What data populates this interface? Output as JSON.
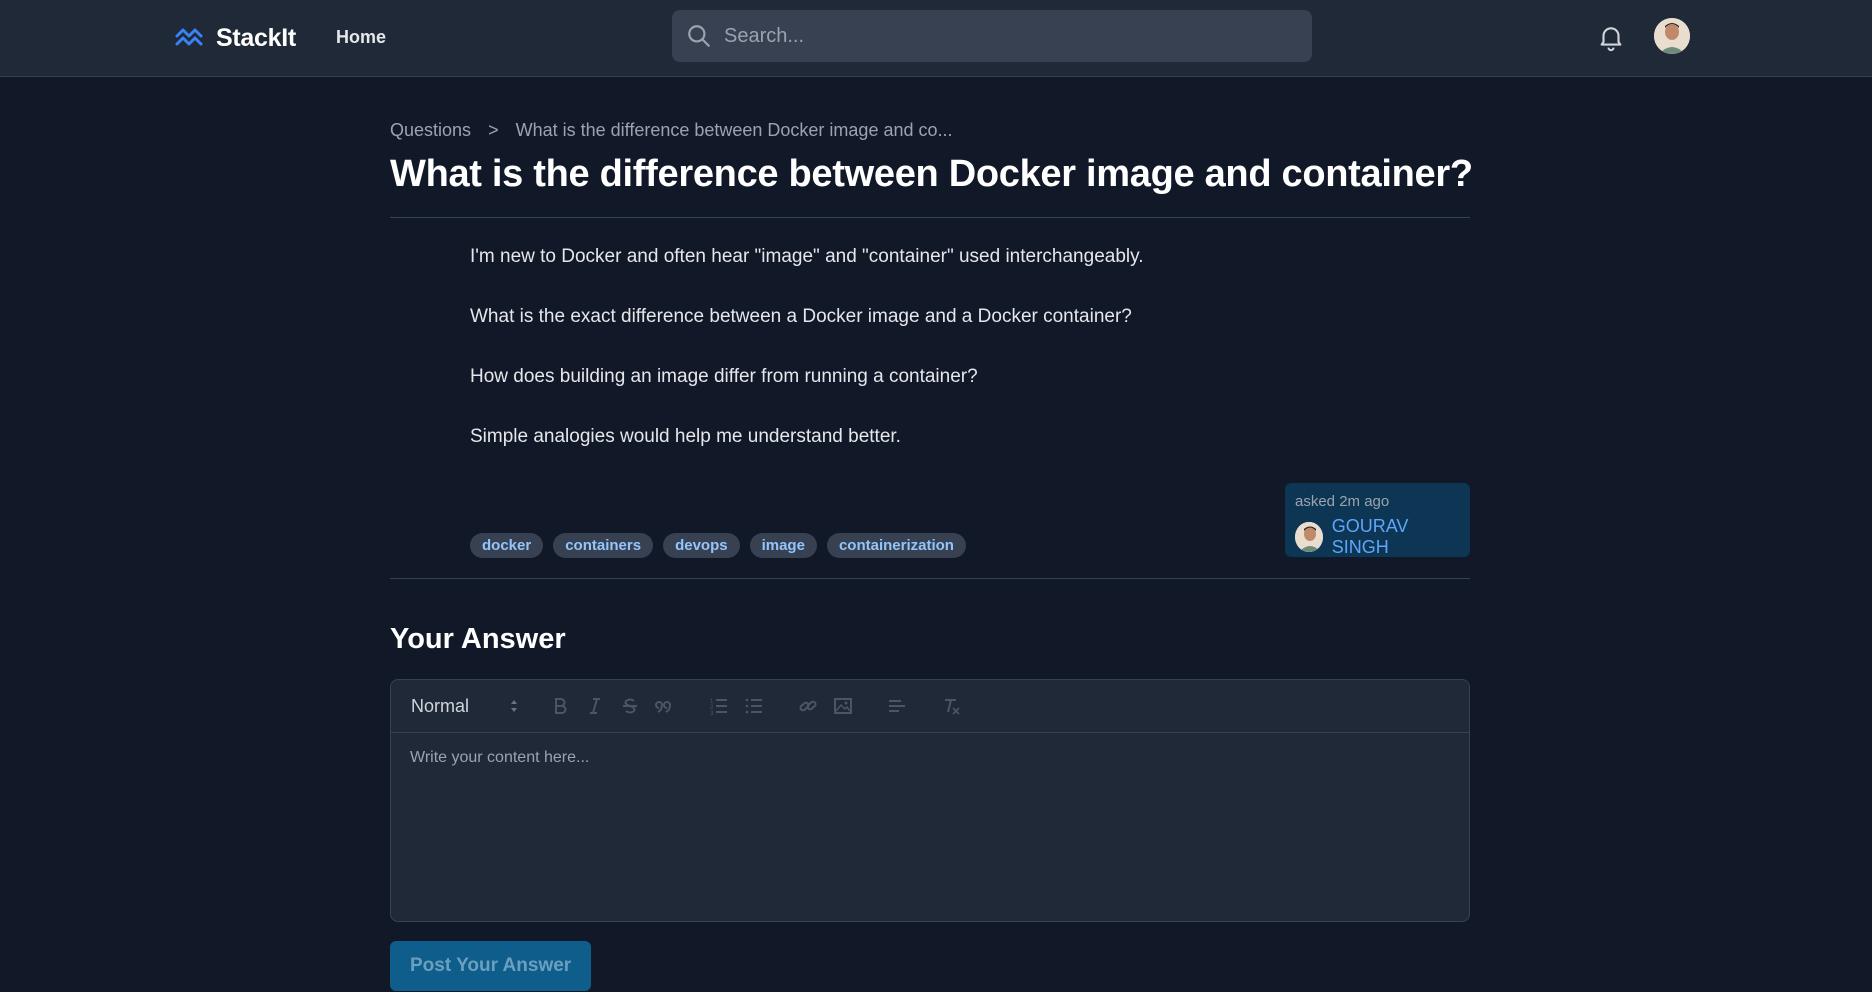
{
  "header": {
    "brand": "StackIt",
    "nav_home": "Home",
    "search_placeholder": "Search...",
    "accent_color": "#3b82f6"
  },
  "breadcrumb": {
    "root": "Questions",
    "separator": ">",
    "current": "What is the difference between Docker image and co..."
  },
  "question": {
    "title": "What is the difference between Docker image and container?",
    "paragraphs": [
      "I'm new to Docker and often hear \"image\" and \"container\" used interchangeably.",
      "What is the exact difference between a Docker image and a Docker container?",
      "How does building an image differ from running a container?",
      "Simple analogies would help me understand better."
    ],
    "tags": [
      "docker",
      "containers",
      "devops",
      "image",
      "containerization"
    ],
    "asked_label": "asked 2m ago",
    "author": "GOURAV SINGH"
  },
  "answer": {
    "heading": "Your Answer",
    "format_select": "Normal",
    "placeholder": "Write your content here...",
    "submit_label": "Post Your Answer",
    "toolbar_icons": [
      "bold-icon",
      "italic-icon",
      "strike-icon",
      "blockquote-icon",
      "ordered-list-icon",
      "bullet-list-icon",
      "link-icon",
      "image-icon",
      "align-icon",
      "clear-format-icon"
    ]
  }
}
